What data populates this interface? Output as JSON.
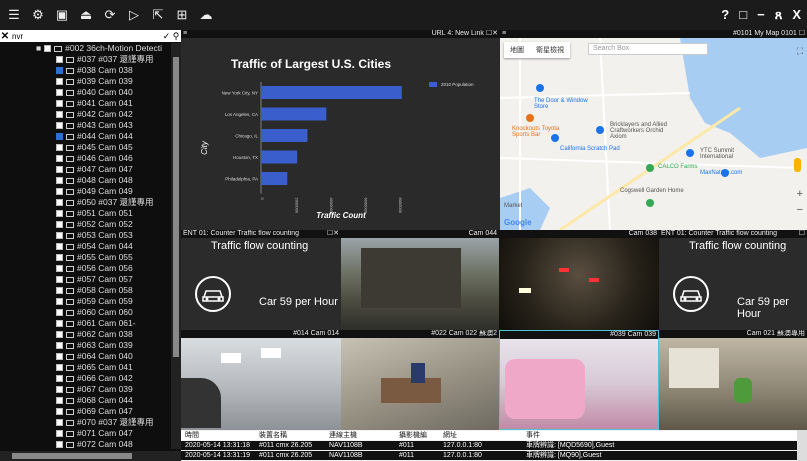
{
  "toolbar": {
    "icons": [
      "menu-icon",
      "gear-icon",
      "screen-icon",
      "upload-icon",
      "refresh-icon",
      "play-icon",
      "export-icon",
      "layout-icon",
      "cloud-icon"
    ],
    "right": [
      "?",
      "□",
      "−",
      "ጸ",
      "X"
    ]
  },
  "left": {
    "search_value": "nvr",
    "group_label": "#002 36ch-Motion Detecti",
    "items": [
      {
        "label": "#037 #037 還謹專用",
        "checked": false
      },
      {
        "label": "#038 Cam 038",
        "checked": true
      },
      {
        "label": "#039 Cam 039",
        "checked": false
      },
      {
        "label": "#040 Cam 040",
        "checked": false
      },
      {
        "label": "#041 Cam 041",
        "checked": false
      },
      {
        "label": "#042 Cam 042",
        "checked": false
      },
      {
        "label": "#043 Cam 043",
        "checked": false
      },
      {
        "label": "#044 Cam 044",
        "checked": true
      },
      {
        "label": "#045 Cam 045",
        "checked": false
      },
      {
        "label": "#046 Cam 046",
        "checked": false
      },
      {
        "label": "#047 Cam 047",
        "checked": false
      },
      {
        "label": "#048 Cam 048",
        "checked": false
      },
      {
        "label": "#049 Cam 049",
        "checked": false
      },
      {
        "label": "#050 #037 還謹專用",
        "checked": false
      },
      {
        "label": "#051 Cam 051",
        "checked": false
      },
      {
        "label": "#052 Cam 052",
        "checked": false
      },
      {
        "label": "#053 Cam 053",
        "checked": false
      },
      {
        "label": "#054 Cam 044",
        "checked": false
      },
      {
        "label": "#055 Cam 055",
        "checked": false
      },
      {
        "label": "#056 Cam 056",
        "checked": false
      },
      {
        "label": "#057 Cam 057",
        "checked": false
      },
      {
        "label": "#058 Cam 058",
        "checked": false
      },
      {
        "label": "#059 Cam 059",
        "checked": false
      },
      {
        "label": "#060 Cam 060",
        "checked": false
      },
      {
        "label": "#061 Cam 061-",
        "checked": false
      },
      {
        "label": "#062 Cam 038",
        "checked": false
      },
      {
        "label": "#063 Cam 039",
        "checked": false
      },
      {
        "label": "#064 Cam 040",
        "checked": false
      },
      {
        "label": "#065 Cam 041",
        "checked": false
      },
      {
        "label": "#066 Cam 042",
        "checked": false
      },
      {
        "label": "#067 Cam 039",
        "checked": false
      },
      {
        "label": "#068 Cam 044",
        "checked": false
      },
      {
        "label": "#069 Cam 047",
        "checked": false
      },
      {
        "label": "#070 #037 還謹專用",
        "checked": false
      },
      {
        "label": "#071 Cam 047",
        "checked": false
      },
      {
        "label": "#072 Cam 048",
        "checked": false
      }
    ]
  },
  "panels": {
    "chart_title_bar": "URL 4: New Link",
    "map_title_bar": "#0101 My Map 0101",
    "counter1_title_bar": "ENT 01: Counter Traffic flow counting",
    "cam044_title": "Cam 044",
    "cam038_title": "Cam 038",
    "counter2_title_bar": "ENT 01: Counter Traffic flow counting",
    "cam014_title": "#014 Cam 014",
    "cam022_title": "#022 Cam 022 蘇澳2",
    "cam039_title": "#039 Cam 039",
    "cam021_title": "Cam 021 蘇澳專用"
  },
  "counter": {
    "title": "Traffic flow counting",
    "rate": "Car 59 per Hour"
  },
  "map": {
    "tabs": [
      "地圖",
      "衛星檢視"
    ],
    "search_placeholder": "Search Box",
    "places": [
      "The Door & Window Store",
      "Knockouts Toyota Sports Bar",
      "Bricklayers and Allied Craftworkers Orchid Axiom",
      "California Scratch Pad",
      "YTC Summit International",
      "CALCO Farms",
      "MaxNature.com",
      "Cogswell Garden Home",
      "Market",
      "Google"
    ]
  },
  "chart_data": {
    "type": "bar",
    "orientation": "horizontal",
    "title": "Traffic of Largest U.S. Cities",
    "xlabel": "Traffic Count",
    "ylabel": "City",
    "categories": [
      "New York City, NY",
      "Los Angeles, CA",
      "Chicago, IL",
      "Houston, TX",
      "Philadelphia, PA"
    ],
    "series": [
      {
        "name": "2010 Population",
        "values": [
          8175133,
          3792621,
          2695598,
          2099451,
          1526006
        ]
      }
    ],
    "xlim": [
      0,
      9000000
    ],
    "xticks": [
      "0",
      "2000000",
      "4000000",
      "6000000",
      "8000000"
    ],
    "legend_position": "top-right",
    "bar_color": "#3a5fcd"
  },
  "log": {
    "headers": [
      "時間",
      "裝置名稱",
      "連線主機",
      "攝影機編",
      "網址",
      "事件"
    ],
    "rows": [
      [
        "2020-05-14 13:31:18",
        "#011 cmx 26.205",
        "NAV1108B",
        "#011",
        "127.0.0.1:80",
        "車牌辨識: [MQD5690],Guest"
      ],
      [
        "2020-05-14 13:31:19",
        "#011 cmx 26.205",
        "NAV1108B",
        "#011",
        "127.0.0.1:80",
        "車牌辨識: [MQ90],Guest"
      ]
    ]
  }
}
